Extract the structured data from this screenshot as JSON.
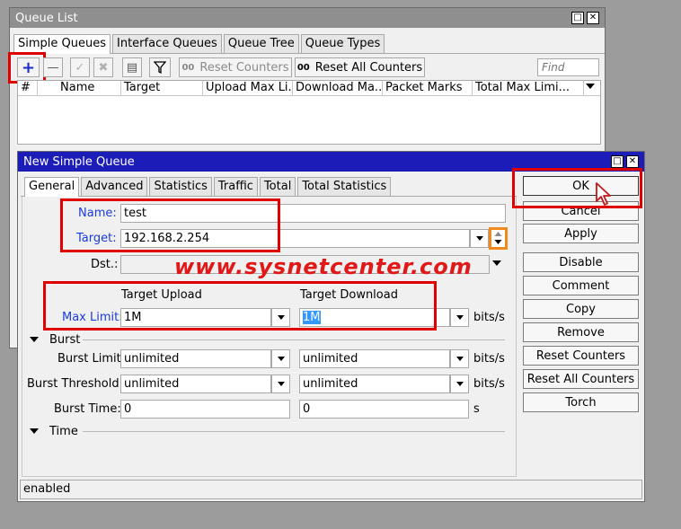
{
  "queue_list": {
    "title": "Queue List",
    "tabs": [
      "Simple Queues",
      "Interface Queues",
      "Queue Tree",
      "Queue Types"
    ],
    "toolbar": {
      "reset_counters": "Reset Counters",
      "reset_all_counters": "Reset All Counters",
      "find_placeholder": "Find"
    },
    "columns": [
      "#",
      "Name",
      "Target",
      "Upload Max Li...",
      "Download Ma...",
      "Packet Marks",
      "Total Max Limi..."
    ]
  },
  "dialog": {
    "title": "New Simple Queue",
    "tabs": [
      "General",
      "Advanced",
      "Statistics",
      "Traffic",
      "Total",
      "Total Statistics"
    ],
    "name_label": "Name:",
    "name_value": "test",
    "target_label": "Target:",
    "target_value": "192.168.2.254",
    "dst_label": "Dst.:",
    "dst_value": "",
    "target_upload_header": "Target Upload",
    "target_download_header": "Target Download",
    "max_limit_label": "Max Limit:",
    "max_limit_upload": "1M",
    "max_limit_download": "1M",
    "burst_section": "Burst",
    "burst_limit_label": "Burst Limit:",
    "burst_limit_upload": "unlimited",
    "burst_limit_download": "unlimited",
    "burst_threshold_label": "Burst Threshold:",
    "burst_threshold_upload": "unlimited",
    "burst_threshold_download": "unlimited",
    "burst_time_label": "Burst Time:",
    "burst_time_upload": "0",
    "burst_time_download": "0",
    "unit_bits": "bits/s",
    "unit_seconds": "s",
    "time_section": "Time",
    "status": "enabled",
    "buttons": {
      "ok": "OK",
      "cancel": "Cancel",
      "apply": "Apply",
      "disable": "Disable",
      "comment": "Comment",
      "copy": "Copy",
      "remove": "Remove",
      "reset_counters": "Reset Counters",
      "reset_all_counters": "Reset All Counters",
      "torch": "Torch"
    }
  },
  "watermark": "www.sysnetcenter.com",
  "colors": {
    "titlebar": "#1c1cb8",
    "highlight_red": "#e00000",
    "label_blue": "#1a3bdb",
    "watermark_red": "#e01818",
    "arrow_box_orange": "#f08a1c",
    "selection_blue": "#3399ff"
  }
}
